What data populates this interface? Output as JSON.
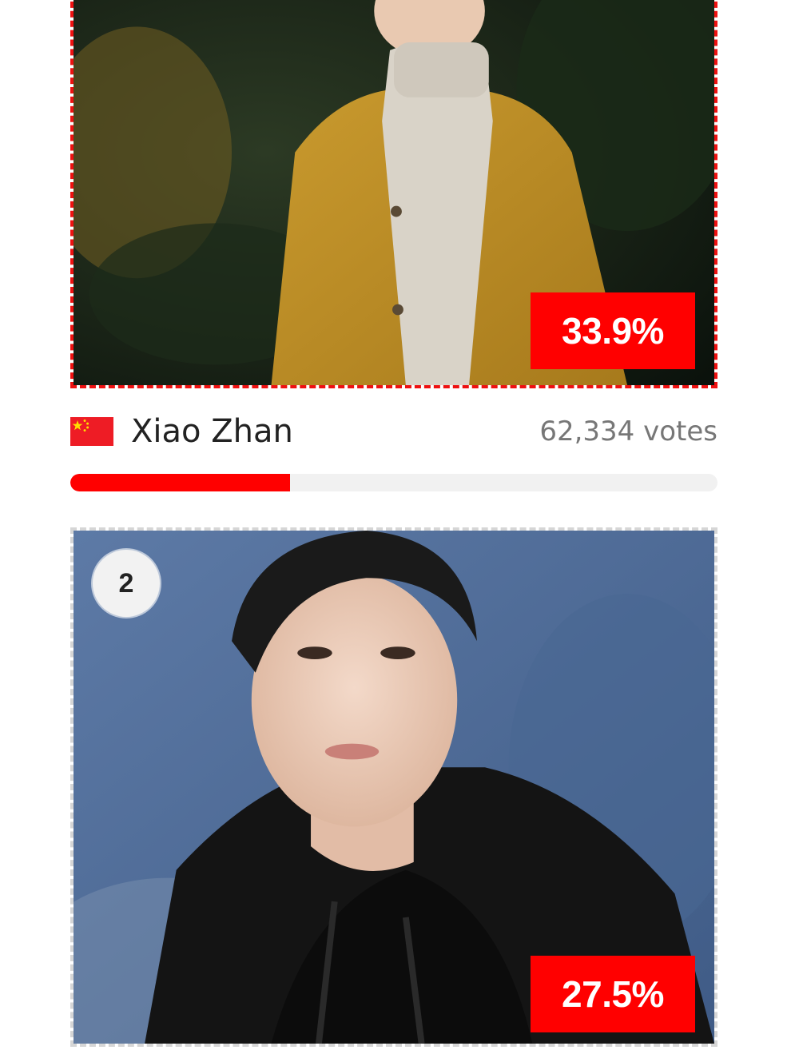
{
  "candidates": [
    {
      "name": "Xiao Zhan",
      "votes_text": "62,334 votes",
      "percent_text": "33.9%",
      "vote_share": 0.339,
      "flag": "china-flag",
      "accent": "#ff0000"
    },
    {
      "rank": "2",
      "percent_text": "27.5%",
      "vote_share": 0.275
    }
  ],
  "colors": {
    "accent": "#ff0000",
    "winner_border": "#ee1111",
    "card_border": "#d6d6d6",
    "bar_track": "#f1f1f1"
  }
}
